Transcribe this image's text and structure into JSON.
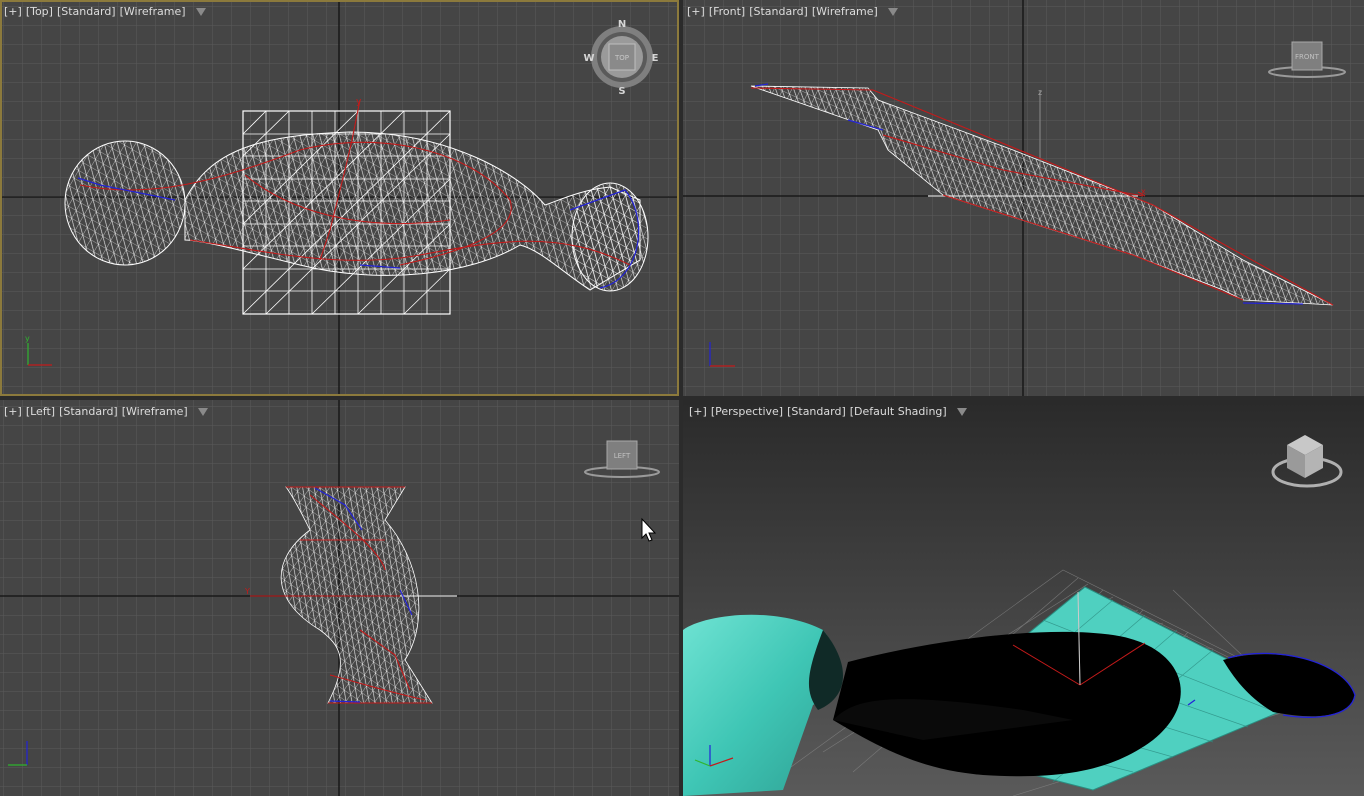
{
  "viewports": {
    "top": {
      "labels": [
        "[+]",
        "[Top]",
        "[Standard]",
        "[Wireframe]"
      ],
      "viewcube": {
        "face": "TOP",
        "n": "N",
        "s": "S",
        "e": "E",
        "w": "W"
      },
      "axis_tag": "y"
    },
    "front": {
      "labels": [
        "[+]",
        "[Front]",
        "[Standard]",
        "[Wireframe]"
      ],
      "viewcube": {
        "face": "FRONT"
      },
      "axis_tags": [
        "z",
        "x"
      ]
    },
    "left": {
      "labels": [
        "[+]",
        "[Left]",
        "[Standard]",
        "[Wireframe]"
      ],
      "viewcube": {
        "face": "LEFT"
      },
      "axis_tag": "Y"
    },
    "perspective": {
      "labels": [
        "[+]",
        "[Perspective]",
        "[Standard]",
        "[Default Shading]"
      ],
      "viewcube": {
        "face": "TOP"
      }
    }
  },
  "colors": {
    "viewport_bg": "#454545",
    "grid": "#5f5f5f",
    "active_border": "#8c7a3c",
    "mesh": "#ffffff",
    "spline_red": "#c41a1a",
    "spline_blue": "#2323d8",
    "plane_cyan": "#4fd0c0"
  },
  "icons": [
    "filter-icon",
    "viewcube-icon",
    "axis-tripod-icon",
    "mouse-cursor-icon"
  ]
}
